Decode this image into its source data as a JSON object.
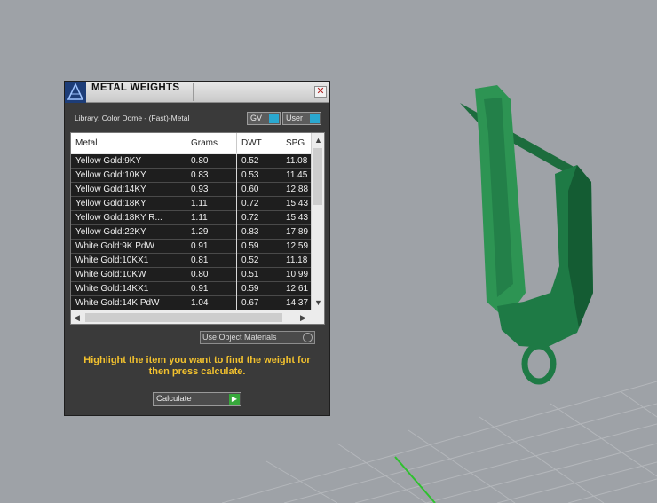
{
  "panel": {
    "title": "METAL WEIGHTS",
    "close_label": "✕",
    "library_label": "Library: Color Dome - (Fast)-Metal",
    "gv_label": "GV",
    "user_label": "User",
    "use_materials_label": "Use Object Materials",
    "instruction": "Highlight the item you want to find the weight for then press calculate.",
    "calculate_label": "Calculate"
  },
  "table": {
    "headers": [
      "Metal",
      "Grams",
      "DWT",
      "SPG"
    ],
    "rows": [
      [
        "Yellow Gold:9KY",
        "0.80",
        "0.52",
        "11.08"
      ],
      [
        "Yellow Gold:10KY",
        "0.83",
        "0.53",
        "11.45"
      ],
      [
        "Yellow Gold:14KY",
        "0.93",
        "0.60",
        "12.88"
      ],
      [
        "Yellow Gold:18KY",
        "1.11",
        "0.72",
        "15.43"
      ],
      [
        "Yellow Gold:18KY R...",
        "1.11",
        "0.72",
        "15.43"
      ],
      [
        "Yellow Gold:22KY",
        "1.29",
        "0.83",
        "17.89"
      ],
      [
        "White Gold:9K PdW",
        "0.91",
        "0.59",
        "12.59"
      ],
      [
        "White Gold:10KX1",
        "0.81",
        "0.52",
        "11.18"
      ],
      [
        "White Gold:10KW",
        "0.80",
        "0.51",
        "10.99"
      ],
      [
        "White Gold:14KX1",
        "0.91",
        "0.59",
        "12.61"
      ],
      [
        "White Gold:14K PdW",
        "1.04",
        "0.67",
        "14.37"
      ]
    ]
  },
  "icons": {
    "scroll_up": "▲",
    "scroll_down": "▼",
    "scroll_left": "◀",
    "scroll_right": "▶",
    "go": "▶"
  },
  "colors": {
    "model": "#1f7a45",
    "accent": "#2aa8d0",
    "instruction": "#f2c12e"
  }
}
